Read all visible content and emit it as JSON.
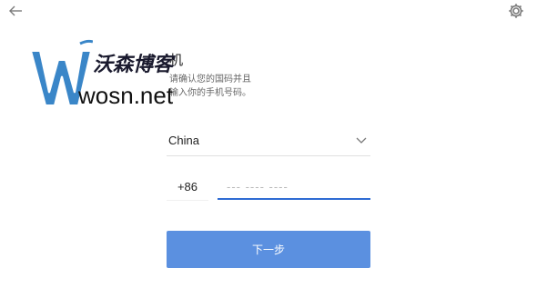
{
  "header": {
    "back_icon": "arrow-left-icon",
    "settings_icon": "gear-icon"
  },
  "main": {
    "title": "机",
    "subtitle": "请确认您的国码并且 输入你的手机号码。"
  },
  "form": {
    "country_label": "China",
    "country_code": "+86",
    "phone_placeholder": "--- ---- ----",
    "next_label": "下一步"
  },
  "watermark": {
    "cn_text": "沃森博客",
    "url_text": "wosn.net",
    "logo_letter": "W"
  },
  "colors": {
    "accent": "#2f6cd3",
    "button": "#5b90e0",
    "logo": "#3a86c8"
  }
}
